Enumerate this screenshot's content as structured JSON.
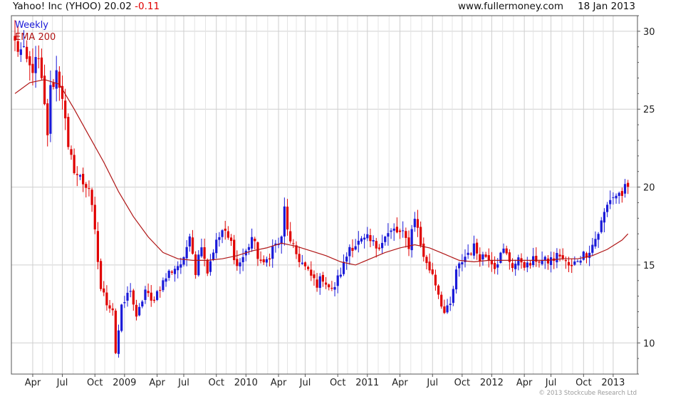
{
  "header": {
    "name": "Yahoo! Inc (YHOO)",
    "price": "20.02",
    "change": "-0.11",
    "site": "www.fullermoney.com",
    "date": "18 Jan 2013"
  },
  "copyright": "© 2013 Stockcube Research Ltd",
  "colors": {
    "up": "#1a1ad8",
    "down": "#e00000",
    "ema": "#b01515",
    "grid": "#cfcfcf",
    "frame": "#555555",
    "weekly_label": "#1a1ad8",
    "ema_label": "#b01515"
  },
  "chart_data": {
    "type": "candlestick",
    "interval": "Weekly",
    "ema_label": "EMA 200",
    "x_range": [
      0,
      209
    ],
    "y_range": [
      8,
      31
    ],
    "grid": true,
    "y_axis_position": "right",
    "y_ticks": [
      10,
      15,
      20,
      25,
      30
    ],
    "x_ticks": [
      {
        "label": "Apr",
        "x": 6
      },
      {
        "label": "Jul",
        "x": 16
      },
      {
        "label": "Oct",
        "x": 27
      },
      {
        "label": "2009",
        "x": 37
      },
      {
        "label": "Apr",
        "x": 48
      },
      {
        "label": "Jul",
        "x": 57
      },
      {
        "label": "Oct",
        "x": 68
      },
      {
        "label": "2010",
        "x": 78
      },
      {
        "label": "Apr",
        "x": 89
      },
      {
        "label": "Jul",
        "x": 98
      },
      {
        "label": "Oct",
        "x": 109
      },
      {
        "label": "2011",
        "x": 119
      },
      {
        "label": "Apr",
        "x": 130
      },
      {
        "label": "Jul",
        "x": 141
      },
      {
        "label": "Oct",
        "x": 151
      },
      {
        "label": "2012",
        "x": 161
      },
      {
        "label": "Apr",
        "x": 172
      },
      {
        "label": "Jul",
        "x": 181
      },
      {
        "label": "Oct",
        "x": 192
      },
      {
        "label": "2013",
        "x": 202
      }
    ],
    "anchor_closes": [
      [
        0,
        29.2
      ],
      [
        3,
        28.4
      ],
      [
        5,
        27.6
      ],
      [
        8,
        28.0
      ],
      [
        9,
        26.6
      ],
      [
        11,
        23.5
      ],
      [
        12,
        26.2
      ],
      [
        14,
        27.4
      ],
      [
        16,
        26.0
      ],
      [
        18,
        22.2
      ],
      [
        21,
        20.8
      ],
      [
        23,
        20.3
      ],
      [
        25,
        20.0
      ],
      [
        27,
        17.0
      ],
      [
        29,
        13.5
      ],
      [
        31,
        12.6
      ],
      [
        33,
        12.2
      ],
      [
        34,
        9.4
      ],
      [
        36,
        12.2
      ],
      [
        39,
        13.5
      ],
      [
        41,
        11.5
      ],
      [
        44,
        13.4
      ],
      [
        46,
        12.6
      ],
      [
        49,
        13.6
      ],
      [
        52,
        14.5
      ],
      [
        55,
        15.0
      ],
      [
        57,
        15.2
      ],
      [
        59,
        17.2
      ],
      [
        61,
        14.6
      ],
      [
        63,
        16.5
      ],
      [
        65,
        14.6
      ],
      [
        67,
        16.0
      ],
      [
        70,
        17.2
      ],
      [
        73,
        16.4
      ],
      [
        75,
        14.9
      ],
      [
        78,
        15.8
      ],
      [
        80,
        16.8
      ],
      [
        82,
        15.6
      ],
      [
        84,
        14.9
      ],
      [
        87,
        16.1
      ],
      [
        90,
        16.6
      ],
      [
        91,
        18.6
      ],
      [
        93,
        16.3
      ],
      [
        96,
        15.4
      ],
      [
        99,
        14.5
      ],
      [
        102,
        13.8
      ],
      [
        104,
        14.2
      ],
      [
        107,
        13.3
      ],
      [
        109,
        14.1
      ],
      [
        111,
        15.0
      ],
      [
        113,
        16.2
      ],
      [
        116,
        16.4
      ],
      [
        119,
        16.6
      ],
      [
        122,
        16.2
      ],
      [
        125,
        16.8
      ],
      [
        128,
        17.2
      ],
      [
        131,
        16.9
      ],
      [
        133,
        16.3
      ],
      [
        135,
        18.2
      ],
      [
        137,
        16.3
      ],
      [
        139,
        15.0
      ],
      [
        141,
        14.5
      ],
      [
        143,
        13.2
      ],
      [
        145,
        11.9
      ],
      [
        147,
        12.4
      ],
      [
        149,
        14.5
      ],
      [
        151,
        15.3
      ],
      [
        153,
        15.8
      ],
      [
        155,
        16.1
      ],
      [
        157,
        15.6
      ],
      [
        160,
        15.6
      ],
      [
        162,
        15.0
      ],
      [
        165,
        15.9
      ],
      [
        168,
        15.0
      ],
      [
        171,
        15.3
      ],
      [
        173,
        14.9
      ],
      [
        176,
        15.4
      ],
      [
        179,
        15.2
      ],
      [
        182,
        15.4
      ],
      [
        184,
        15.7
      ],
      [
        186,
        15.1
      ],
      [
        188,
        14.8
      ],
      [
        190,
        15.4
      ],
      [
        193,
        15.8
      ],
      [
        195,
        16.3
      ],
      [
        197,
        17.1
      ],
      [
        199,
        18.3
      ],
      [
        201,
        19.3
      ],
      [
        203,
        19.5
      ],
      [
        205,
        19.6
      ],
      [
        207,
        20.02
      ]
    ],
    "ema_points": [
      [
        0,
        26.0
      ],
      [
        5,
        26.7
      ],
      [
        10,
        26.9
      ],
      [
        15,
        26.6
      ],
      [
        20,
        25.0
      ],
      [
        25,
        23.3
      ],
      [
        30,
        21.6
      ],
      [
        35,
        19.7
      ],
      [
        40,
        18.1
      ],
      [
        45,
        16.8
      ],
      [
        50,
        15.8
      ],
      [
        55,
        15.4
      ],
      [
        60,
        15.3
      ],
      [
        65,
        15.3
      ],
      [
        70,
        15.4
      ],
      [
        75,
        15.6
      ],
      [
        80,
        15.9
      ],
      [
        85,
        16.1
      ],
      [
        90,
        16.4
      ],
      [
        95,
        16.2
      ],
      [
        100,
        15.9
      ],
      [
        105,
        15.6
      ],
      [
        110,
        15.2
      ],
      [
        115,
        15.0
      ],
      [
        120,
        15.4
      ],
      [
        125,
        15.8
      ],
      [
        130,
        16.1
      ],
      [
        135,
        16.3
      ],
      [
        140,
        16.1
      ],
      [
        145,
        15.7
      ],
      [
        150,
        15.3
      ],
      [
        155,
        15.2
      ],
      [
        160,
        15.3
      ],
      [
        165,
        15.3
      ],
      [
        170,
        15.3
      ],
      [
        175,
        15.3
      ],
      [
        180,
        15.3
      ],
      [
        185,
        15.4
      ],
      [
        190,
        15.4
      ],
      [
        195,
        15.6
      ],
      [
        200,
        16.0
      ],
      [
        205,
        16.6
      ],
      [
        207,
        17.0
      ]
    ]
  }
}
